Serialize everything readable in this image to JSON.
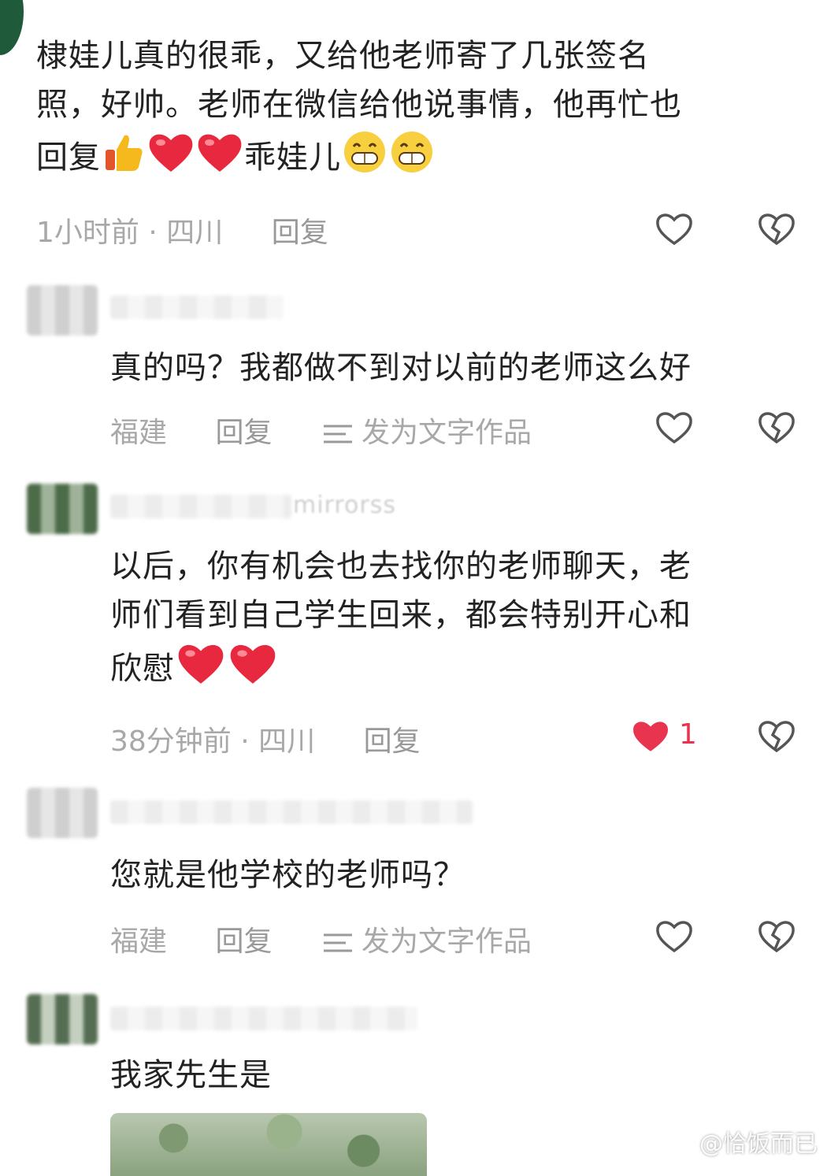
{
  "comments": [
    {
      "text_lines": [
        "棣娃儿真的很乖，又给他老师寄了几张签名",
        "照，好帅。老师在微信给他说事情，他再忙也",
        "回复"
      ],
      "text_tail": "乖娃儿",
      "time": "1小时前 · 四川",
      "reply_label": "回复"
    },
    {
      "text": "真的吗？我都做不到对以前的老师这么好",
      "location": "福建",
      "reply_label": "回复",
      "publish_label": "发为文字作品"
    },
    {
      "name_hint": "mirrorss",
      "text_lines": [
        "以后，你有机会也去找你的老师聊天，老",
        "师们看到自己学生回来，都会特别开心和",
        "欣慰"
      ],
      "time": "38分钟前 · 四川",
      "reply_label": "回复",
      "like_count": "1"
    },
    {
      "text": "您就是他学校的老师吗？",
      "location": "福建",
      "reply_label": "回复",
      "publish_label": "发为文字作品"
    },
    {
      "text": "我家先生是"
    }
  ],
  "watermark": "@恰饭而已",
  "colors": {
    "liked": "#e8344e",
    "meta": "#a8a8a8",
    "icon": "#555555"
  },
  "icons": [
    "heart-outline-icon",
    "broken-heart-icon",
    "heart-filled-icon",
    "thumbs-up-emoji-icon",
    "red-heart-emoji-icon",
    "grin-emoji-icon",
    "list-icon",
    "weibo-icon"
  ]
}
